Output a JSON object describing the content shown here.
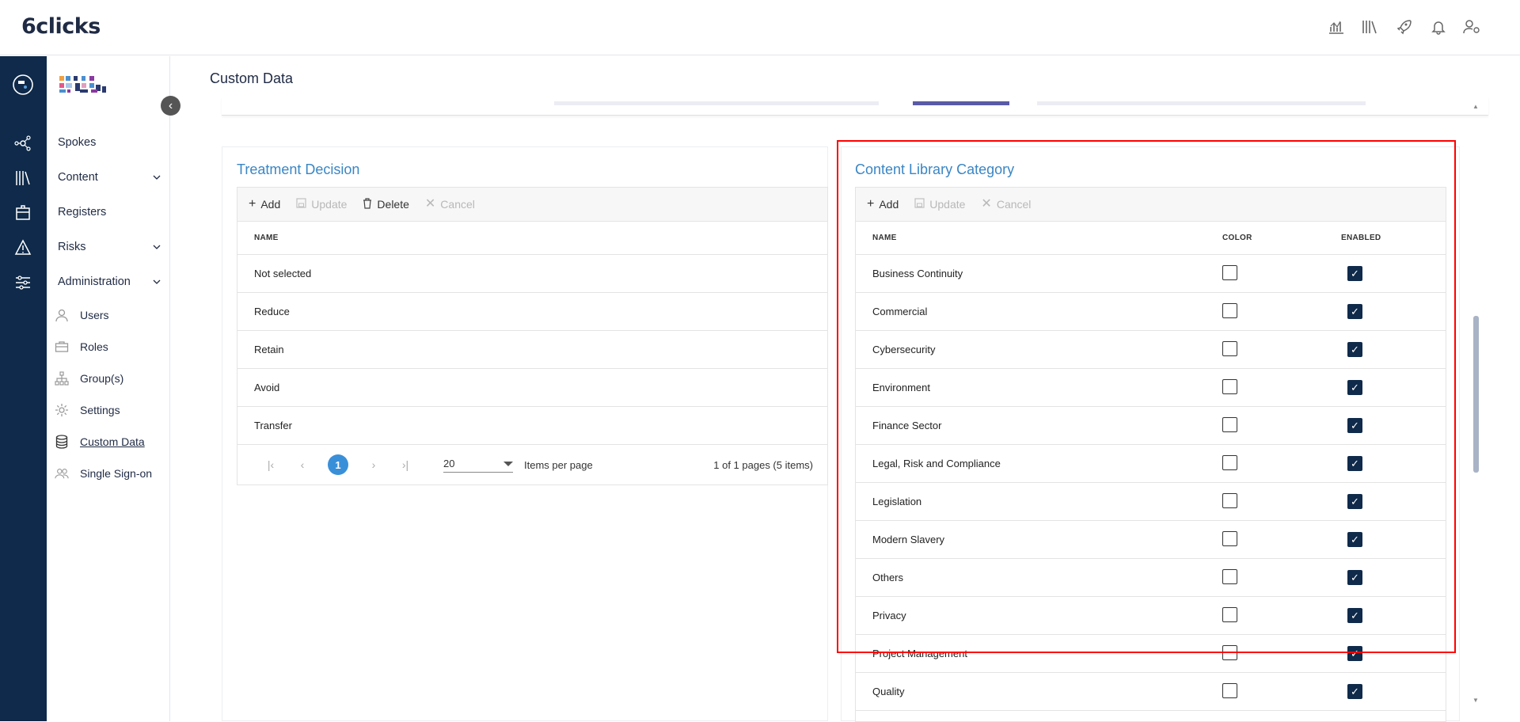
{
  "app": {
    "logo_text": "6clicks",
    "page_title": "Custom Data"
  },
  "topbar_icons": [
    "analytics-icon",
    "library-icon",
    "rocket-icon",
    "bell-icon",
    "user-settings-icon"
  ],
  "rail_icons": [
    "hub-logo-icon",
    "spokes-network-icon",
    "library-books-icon",
    "registers-box-icon",
    "risk-warning-icon",
    "admin-sliders-icon"
  ],
  "sidebar": {
    "collapse_glyph": "‹",
    "items": [
      {
        "label": "Spokes",
        "expandable": false
      },
      {
        "label": "Content",
        "expandable": true
      },
      {
        "label": "Registers",
        "expandable": false
      },
      {
        "label": "Risks",
        "expandable": true
      },
      {
        "label": "Administration",
        "expandable": true
      }
    ],
    "sub_items": [
      {
        "label": "Users",
        "icon": "user-icon"
      },
      {
        "label": "Roles",
        "icon": "briefcase-icon"
      },
      {
        "label": "Group(s)",
        "icon": "org-chart-icon"
      },
      {
        "label": "Settings",
        "icon": "gear-icon"
      },
      {
        "label": "Custom Data",
        "icon": "database-icon",
        "active": true
      },
      {
        "label": "Single Sign-on",
        "icon": "users-icon"
      }
    ]
  },
  "toolbar": {
    "add": "Add",
    "update": "Update",
    "delete": "Delete",
    "cancel": "Cancel"
  },
  "treatment": {
    "title": "Treatment Decision",
    "column_name": "NAME",
    "rows": [
      "Not selected",
      "Reduce",
      "Retain",
      "Avoid",
      "Transfer"
    ],
    "pager": {
      "current_page": "1",
      "page_size": "20",
      "items_per_page_label": "Items per page",
      "summary": "1 of 1 pages (5 items)"
    }
  },
  "content_library": {
    "title": "Content Library Category",
    "columns": {
      "name": "NAME",
      "color": "COLOR",
      "enabled": "ENABLED"
    },
    "rows": [
      {
        "name": "Business Continuity",
        "color": false,
        "enabled": true
      },
      {
        "name": "Commercial",
        "color": false,
        "enabled": true
      },
      {
        "name": "Cybersecurity",
        "color": false,
        "enabled": true
      },
      {
        "name": "Environment",
        "color": false,
        "enabled": true
      },
      {
        "name": "Finance Sector",
        "color": false,
        "enabled": true
      },
      {
        "name": "Legal, Risk and Compliance",
        "color": false,
        "enabled": true
      },
      {
        "name": "Legislation",
        "color": false,
        "enabled": true
      },
      {
        "name": "Modern Slavery",
        "color": false,
        "enabled": true
      },
      {
        "name": "Others",
        "color": false,
        "enabled": true
      },
      {
        "name": "Privacy",
        "color": false,
        "enabled": true
      },
      {
        "name": "Project Management",
        "color": false,
        "enabled": true
      },
      {
        "name": "Quality",
        "color": false,
        "enabled": true
      }
    ]
  },
  "colors": {
    "rail": "#0f2a4a",
    "accent_title": "#3a86c4",
    "pager_current": "#3a8fd9",
    "highlight_box": "#ff0000"
  }
}
